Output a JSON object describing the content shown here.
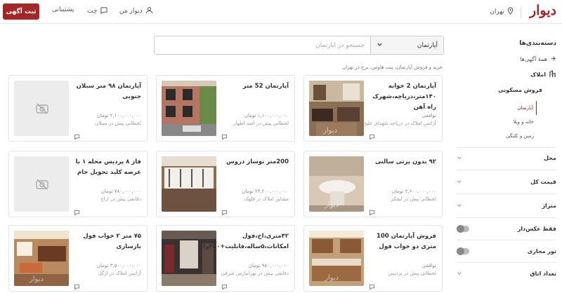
{
  "header": {
    "logo": "دیوار",
    "city": "تهران",
    "my_divar": "دیوار من",
    "chat": "چت",
    "support": "پشتیبانی",
    "post_button": "ثبت آگهی"
  },
  "search": {
    "category": "آپارتمان",
    "placeholder": "جستجو در آپارتمان"
  },
  "breadcrumb": "خرید و فروش آپارتمان، پنت هاوس، برج در تهران",
  "sidebar": {
    "title": "دسته‌بندی‌ها",
    "all_ads": "همهٔ آگهی‌ها",
    "category": "املاک",
    "subcategory": "فروش مسکونی",
    "sub_items": [
      "آپارتمان",
      "خانه و ویلا",
      "زمین و کلنگی"
    ],
    "filters": {
      "location": "محل",
      "total_price": "قیمت کل",
      "area": "متراژ",
      "photo_only": "فقط عکس‌دار",
      "virtual_tour": "تور مجازی",
      "rooms": "تعداد اتاق"
    }
  },
  "listings": [
    {
      "title": "آپارتمان 2 خوابه ۱۴۰متر،دریاچه،شهرک راه آهن",
      "line1": "توافقی",
      "line2": "",
      "meta": "آژانس املاک در دریاچه شهدای خلیج...",
      "image": "apartment-living-room-photo"
    },
    {
      "title": "آپارتمان 52 متر",
      "line1": "۱,۱۰۰,۰۰۰,۰۰۰ تومان",
      "line2": "",
      "meta": "لحظاتی پیش در ائمه اطهار",
      "image": "building-facade-photo"
    },
    {
      "title": "آپارتمان ۹۸ متر سبلان جنوبی",
      "line1": "۲,۱۰۰,۰۰۰,۰۰۰ تومان",
      "line2": "",
      "meta": "لحظاتی پیش در سبلان",
      "image": "no-image-placeholder"
    },
    {
      "title": "۹۲ بدون پرتی سالنی",
      "line1": "۲,۶۰۰,۰۰۰,۰۰۰ تومان",
      "line2": "",
      "meta": "لحظاتی پیش در لشکر",
      "image": "bathroom-sink-photo"
    },
    {
      "title": "200متر نوساز دروس",
      "line1": "۲۴,۲۰۰,۰۰۰,۰۰۰ تومان",
      "line2": "",
      "meta": "مشاور املاک در قلهک",
      "image": "empty-room-windows-photo"
    },
    {
      "title": "فاز ۸ پردیس محله ۱ با عرصه کلید تحویل خام",
      "line1": "۷۸۰,۰۰۰,۰۰۰ تومان",
      "line2": "",
      "meta": "دقایقی پیش در اراج",
      "image": "no-image-placeholder"
    },
    {
      "title": "فروش آپارتمان 100 متری دو خواب فول",
      "line1": "توافقی",
      "line2": "",
      "meta": "لحظاتی پیش در پردیس",
      "image": "kitchen-photo"
    },
    {
      "title": "۴۲متری،اخ،فول امکانات،۵ساله،قابلیت+۲۵۰وام",
      "line1": "۹۸۰,۰۰۰,۰۰۰ تومان",
      "line2": "",
      "meta": "دقایقی پیش در تهرانپارس شرقی",
      "image": "hallway-photo"
    },
    {
      "title": "۷۵ متر ۲ خواب فول بازسازی",
      "line1": "۳,۵۰۰,۰۰۰,۰۰۰ تومان",
      "line2": "",
      "meta": "آژانس املاک در ارگل",
      "image": "living-room-dining-photo"
    }
  ],
  "colors": {
    "brand": "#a62626",
    "border": "#e5e5e5",
    "muted": "#999999"
  }
}
